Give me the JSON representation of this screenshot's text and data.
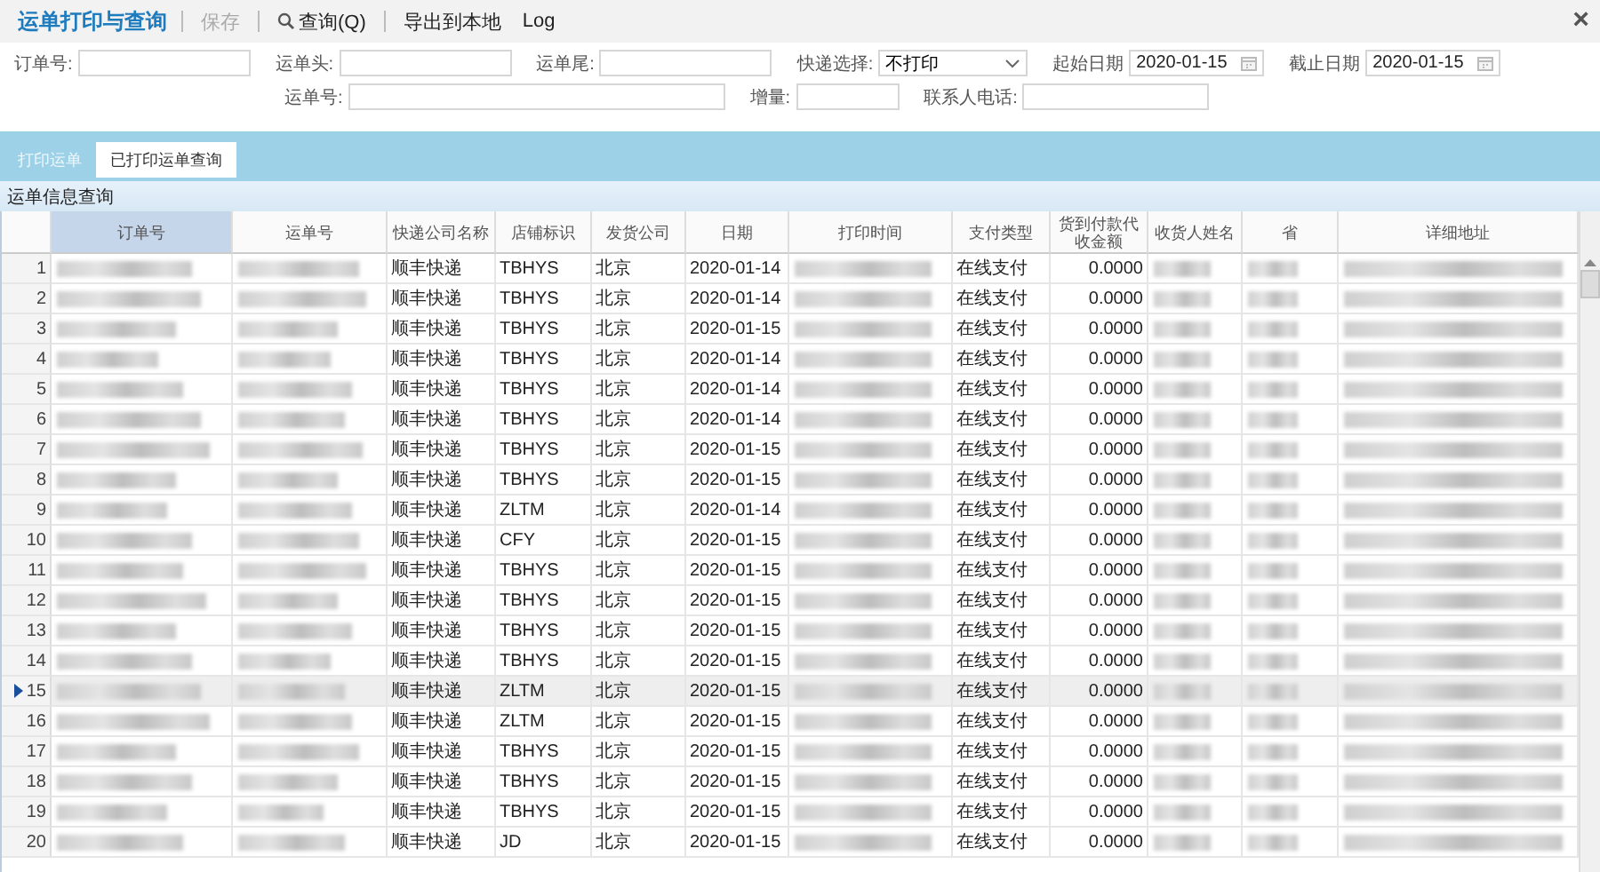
{
  "title": "运单打印与查询",
  "toolbar": [
    {
      "label": "保存",
      "kind": "plain",
      "disabled": true
    },
    {
      "label": "查询(Q)",
      "kind": "search",
      "disabled": false
    },
    {
      "label": "导出到本地",
      "kind": "plain",
      "disabled": false
    },
    {
      "label": "Log",
      "kind": "plain",
      "disabled": false
    }
  ],
  "close": "×",
  "form": {
    "fields": [
      {
        "label": "订单号:",
        "kind": "text"
      },
      {
        "label": "运单头:",
        "kind": "text"
      },
      {
        "label": "运单尾:",
        "kind": "text"
      },
      {
        "label": "快递选择:",
        "kind": "select",
        "value": "不打印"
      },
      {
        "label": "起始日期",
        "kind": "date",
        "value": "2020-01-15"
      },
      {
        "label": "截止日期",
        "kind": "date",
        "value": "2020-01-15"
      },
      {
        "label": "运单号:",
        "kind": "wide"
      },
      {
        "label": "增量:",
        "kind": "short"
      },
      {
        "label": "联系人电话:",
        "kind": "phone"
      }
    ]
  },
  "tabs": [
    {
      "label": "打印运单",
      "selected": false
    },
    {
      "label": "已打印运单查询",
      "selected": true
    }
  ],
  "section_title": "运单信息查询",
  "table": {
    "columns": [
      {
        "label": "订单号",
        "selected": true
      },
      {
        "label": "运单号",
        "selected": false
      },
      {
        "label": "快递公司名称",
        "selected": false
      },
      {
        "label": "店铺标识",
        "selected": false
      },
      {
        "label": "发货公司",
        "selected": false
      },
      {
        "label": "日期",
        "selected": false
      },
      {
        "label": "打印时间",
        "selected": false
      },
      {
        "label": "支付类型",
        "selected": false
      },
      {
        "label": "货到付款代收金额",
        "selected": false
      },
      {
        "label": "收货人姓名",
        "selected": false
      },
      {
        "label": "省",
        "selected": false
      },
      {
        "label": "详细地址",
        "selected": false
      }
    ],
    "rows": [
      {
        "index": "1",
        "company": "顺丰快递",
        "shop": "TBHYS",
        "sender": "北京",
        "date": "2020-01-14",
        "payment": "在线支付",
        "amount": "0.0000",
        "selected": false
      },
      {
        "index": "2",
        "company": "顺丰快递",
        "shop": "TBHYS",
        "sender": "北京",
        "date": "2020-01-14",
        "payment": "在线支付",
        "amount": "0.0000",
        "selected": false
      },
      {
        "index": "3",
        "company": "顺丰快递",
        "shop": "TBHYS",
        "sender": "北京",
        "date": "2020-01-15",
        "payment": "在线支付",
        "amount": "0.0000",
        "selected": false
      },
      {
        "index": "4",
        "company": "顺丰快递",
        "shop": "TBHYS",
        "sender": "北京",
        "date": "2020-01-14",
        "payment": "在线支付",
        "amount": "0.0000",
        "selected": false
      },
      {
        "index": "5",
        "company": "顺丰快递",
        "shop": "TBHYS",
        "sender": "北京",
        "date": "2020-01-14",
        "payment": "在线支付",
        "amount": "0.0000",
        "selected": false
      },
      {
        "index": "6",
        "company": "顺丰快递",
        "shop": "TBHYS",
        "sender": "北京",
        "date": "2020-01-14",
        "payment": "在线支付",
        "amount": "0.0000",
        "selected": false
      },
      {
        "index": "7",
        "company": "顺丰快递",
        "shop": "TBHYS",
        "sender": "北京",
        "date": "2020-01-15",
        "payment": "在线支付",
        "amount": "0.0000",
        "selected": false
      },
      {
        "index": "8",
        "company": "顺丰快递",
        "shop": "TBHYS",
        "sender": "北京",
        "date": "2020-01-15",
        "payment": "在线支付",
        "amount": "0.0000",
        "selected": false
      },
      {
        "index": "9",
        "company": "顺丰快递",
        "shop": "ZLTM",
        "sender": "北京",
        "date": "2020-01-14",
        "payment": "在线支付",
        "amount": "0.0000",
        "selected": false
      },
      {
        "index": "10",
        "company": "顺丰快递",
        "shop": "CFY",
        "sender": "北京",
        "date": "2020-01-15",
        "payment": "在线支付",
        "amount": "0.0000",
        "selected": false
      },
      {
        "index": "11",
        "company": "顺丰快递",
        "shop": "TBHYS",
        "sender": "北京",
        "date": "2020-01-15",
        "payment": "在线支付",
        "amount": "0.0000",
        "selected": false
      },
      {
        "index": "12",
        "company": "顺丰快递",
        "shop": "TBHYS",
        "sender": "北京",
        "date": "2020-01-15",
        "payment": "在线支付",
        "amount": "0.0000",
        "selected": false
      },
      {
        "index": "13",
        "company": "顺丰快递",
        "shop": "TBHYS",
        "sender": "北京",
        "date": "2020-01-15",
        "payment": "在线支付",
        "amount": "0.0000",
        "selected": false
      },
      {
        "index": "14",
        "company": "顺丰快递",
        "shop": "TBHYS",
        "sender": "北京",
        "date": "2020-01-15",
        "payment": "在线支付",
        "amount": "0.0000",
        "selected": false
      },
      {
        "index": "15",
        "company": "顺丰快递",
        "shop": "ZLTM",
        "sender": "北京",
        "date": "2020-01-15",
        "payment": "在线支付",
        "amount": "0.0000",
        "selected": true
      },
      {
        "index": "16",
        "company": "顺丰快递",
        "shop": "ZLTM",
        "sender": "北京",
        "date": "2020-01-15",
        "payment": "在线支付",
        "amount": "0.0000",
        "selected": false
      },
      {
        "index": "17",
        "company": "顺丰快递",
        "shop": "TBHYS",
        "sender": "北京",
        "date": "2020-01-15",
        "payment": "在线支付",
        "amount": "0.0000",
        "selected": false
      },
      {
        "index": "18",
        "company": "顺丰快递",
        "shop": "TBHYS",
        "sender": "北京",
        "date": "2020-01-15",
        "payment": "在线支付",
        "amount": "0.0000",
        "selected": false
      },
      {
        "index": "19",
        "company": "顺丰快递",
        "shop": "TBHYS",
        "sender": "北京",
        "date": "2020-01-15",
        "payment": "在线支付",
        "amount": "0.0000",
        "selected": false
      },
      {
        "index": "20",
        "company": "顺丰快递",
        "shop": "JD",
        "sender": "北京",
        "date": "2020-01-15",
        "payment": "在线支付",
        "amount": "0.0000",
        "selected": false
      }
    ]
  }
}
